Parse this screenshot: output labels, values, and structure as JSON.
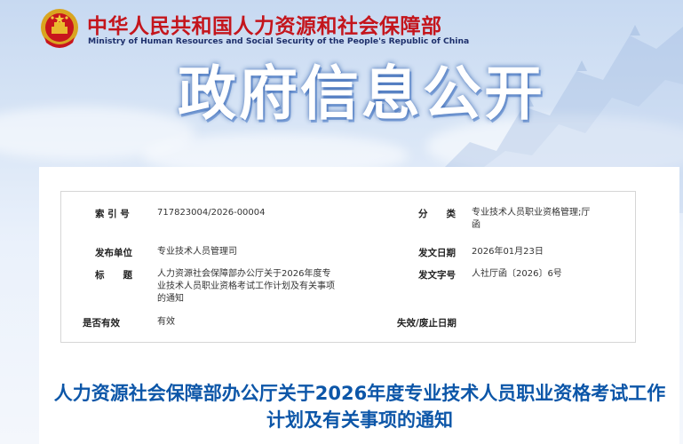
{
  "header": {
    "ministry_cn": "中华人民共和国人力资源和社会保障部",
    "ministry_en": "Ministry of Human Resources and Social Security of the People's Republic of China",
    "banner_title": "政府信息公开"
  },
  "info": {
    "index_label": "索 引 号",
    "index_value": "717823004/2026-00004",
    "category_label": "分　　类",
    "category_value": "专业技术人员职业资格管理;厅函",
    "publisher_label": "发布单位",
    "publisher_value": "专业技术人员管理司",
    "date_label": "发文日期",
    "date_value": "2026年01月23日",
    "title_label": "标　　题",
    "title_value": "人力资源社会保障部办公厅关于2026年度专业技术人员职业资格考试工作计划及有关事项的通知",
    "docno_label": "发文字号",
    "docno_value": "人社厅函〔2026〕6号",
    "valid_label": "是否有效",
    "valid_value": "有效",
    "expiry_label": "失效/废止日期",
    "expiry_value": ""
  },
  "notice": {
    "title": "人力资源社会保障部办公厅关于2026年度专业技术人员职业资格考试工作计划及有关事项的通知"
  },
  "colors": {
    "ministry_red": "#c4151c",
    "notice_blue": "#0c56a8"
  }
}
